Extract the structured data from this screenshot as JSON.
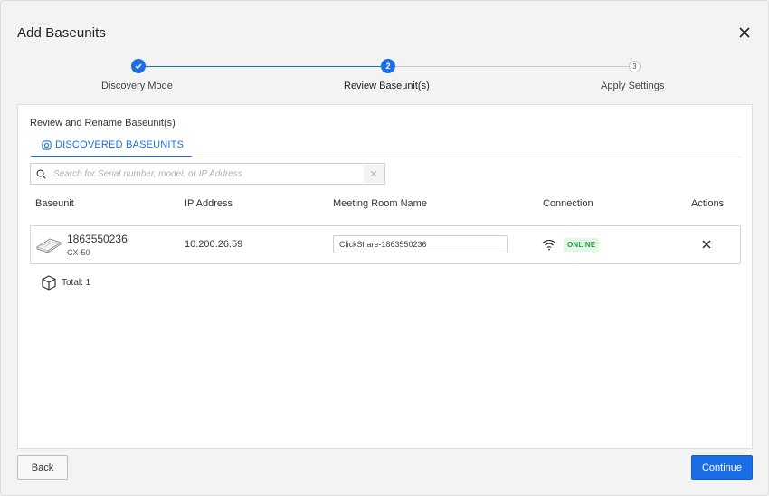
{
  "dialog": {
    "title": "Add Baseunits",
    "close_icon": "close-icon"
  },
  "stepper": {
    "steps": [
      {
        "label": "Discovery Mode",
        "state": "completed",
        "icon": "check-icon"
      },
      {
        "label": "Review Baseunit(s)",
        "state": "active",
        "number": "2"
      },
      {
        "label": "Apply Settings",
        "state": "pending",
        "number": "3"
      }
    ]
  },
  "panel": {
    "title": "Review and Rename Baseunit(s)",
    "tab": {
      "label": "DISCOVERED BASEUNITS",
      "icon": "instagram-like-square-icon"
    },
    "search": {
      "placeholder": "Search for Serial number, model, or IP Address",
      "value": "",
      "clear_icon": "clear-x-icon"
    },
    "columns": [
      "Baseunit",
      "IP Address",
      "Meeting Room Name",
      "Connection",
      "Actions"
    ],
    "rows": [
      {
        "serial": "1863550236",
        "model": "CX-50",
        "ip": "10.200.26.59",
        "room_name": "ClickShare-1863550236",
        "connection_icon": "wifi-icon",
        "status": "ONLINE",
        "action_icon": "close-icon"
      }
    ],
    "total": "Total: 1"
  },
  "footer": {
    "back_label": "Back",
    "continue_label": "Continue"
  },
  "colors": {
    "accent": "#1b6ee6",
    "online_bg": "#e4f7e7",
    "online_text": "#27a046"
  }
}
